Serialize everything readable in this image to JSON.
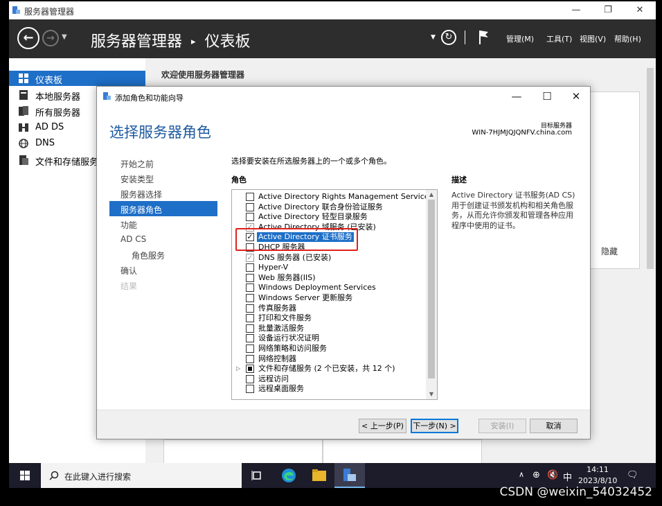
{
  "window": {
    "title": "服务器管理器",
    "min": "—",
    "max": "❐",
    "close": "✕"
  },
  "header": {
    "breadcrumb_app": "服务器管理器",
    "breadcrumb_sep": "▸",
    "breadcrumb_page": "仪表板",
    "menus": [
      "管理(M)",
      "工具(T)",
      "视图(V)",
      "帮助(H)"
    ]
  },
  "sidebar": {
    "items": [
      {
        "label": "仪表板",
        "selected": true
      },
      {
        "label": "本地服务器"
      },
      {
        "label": "所有服务器"
      },
      {
        "label": "AD DS"
      },
      {
        "label": "DNS"
      },
      {
        "label": "文件和存储服务"
      }
    ]
  },
  "main": {
    "welcome": "欢迎使用服务器管理器",
    "hide": "隐藏"
  },
  "wizard": {
    "title": "添加角色和功能向导",
    "heading": "选择服务器角色",
    "dest_label": "目标服务器",
    "dest_server": "WIN-7HJMJQJQNFV.china.com",
    "steps": [
      {
        "label": "开始之前"
      },
      {
        "label": "安装类型"
      },
      {
        "label": "服务器选择"
      },
      {
        "label": "服务器角色",
        "selected": true
      },
      {
        "label": "功能"
      },
      {
        "label": "AD CS"
      },
      {
        "label": "角色服务",
        "sub": true
      },
      {
        "label": "确认"
      },
      {
        "label": "结果",
        "disabled": true
      }
    ],
    "instruction": "选择要安装在所选服务器上的一个或多个角色。",
    "roles_header": "角色",
    "desc_header": "描述",
    "description": "Active Directory 证书服务(AD CS)用于创建证书颁发机构和相关角色服务，从而允许你颁发和管理各种应用程序中使用的证书。",
    "roles": [
      {
        "label": "Active Directory Rights Management Services",
        "state": "none"
      },
      {
        "label": "Active Directory 联合身份验证服务",
        "state": "none"
      },
      {
        "label": "Active Directory 轻型目录服务",
        "state": "none"
      },
      {
        "label": "Active Directory 域服务 (已安装)",
        "state": "installed"
      },
      {
        "label": "Active Directory 证书服务",
        "state": "checked",
        "highlight": true
      },
      {
        "label": "DHCP 服务器",
        "state": "none"
      },
      {
        "label": "DNS 服务器 (已安装)",
        "state": "installed"
      },
      {
        "label": "Hyper-V",
        "state": "none"
      },
      {
        "label": "Web 服务器(IIS)",
        "state": "none"
      },
      {
        "label": "Windows Deployment Services",
        "state": "none"
      },
      {
        "label": "Windows Server 更新服务",
        "state": "none"
      },
      {
        "label": "传真服务器",
        "state": "none"
      },
      {
        "label": "打印和文件服务",
        "state": "none"
      },
      {
        "label": "批量激活服务",
        "state": "none"
      },
      {
        "label": "设备运行状况证明",
        "state": "none"
      },
      {
        "label": "网络策略和访问服务",
        "state": "none"
      },
      {
        "label": "网络控制器",
        "state": "none"
      },
      {
        "label": "文件和存储服务 (2 个已安装，共 12 个)",
        "state": "partial",
        "expandable": true
      },
      {
        "label": "远程访问",
        "state": "none"
      },
      {
        "label": "远程桌面服务",
        "state": "none"
      }
    ],
    "buttons": {
      "prev": "< 上一步(P)",
      "next": "下一步(N) >",
      "install": "安装(I)",
      "cancel": "取消"
    }
  },
  "taskbar": {
    "search_placeholder": "在此键入进行搜索",
    "ime": "中",
    "time": "14:11",
    "date": "2023/8/10"
  },
  "watermark": "CSDN @weixin_54032452"
}
